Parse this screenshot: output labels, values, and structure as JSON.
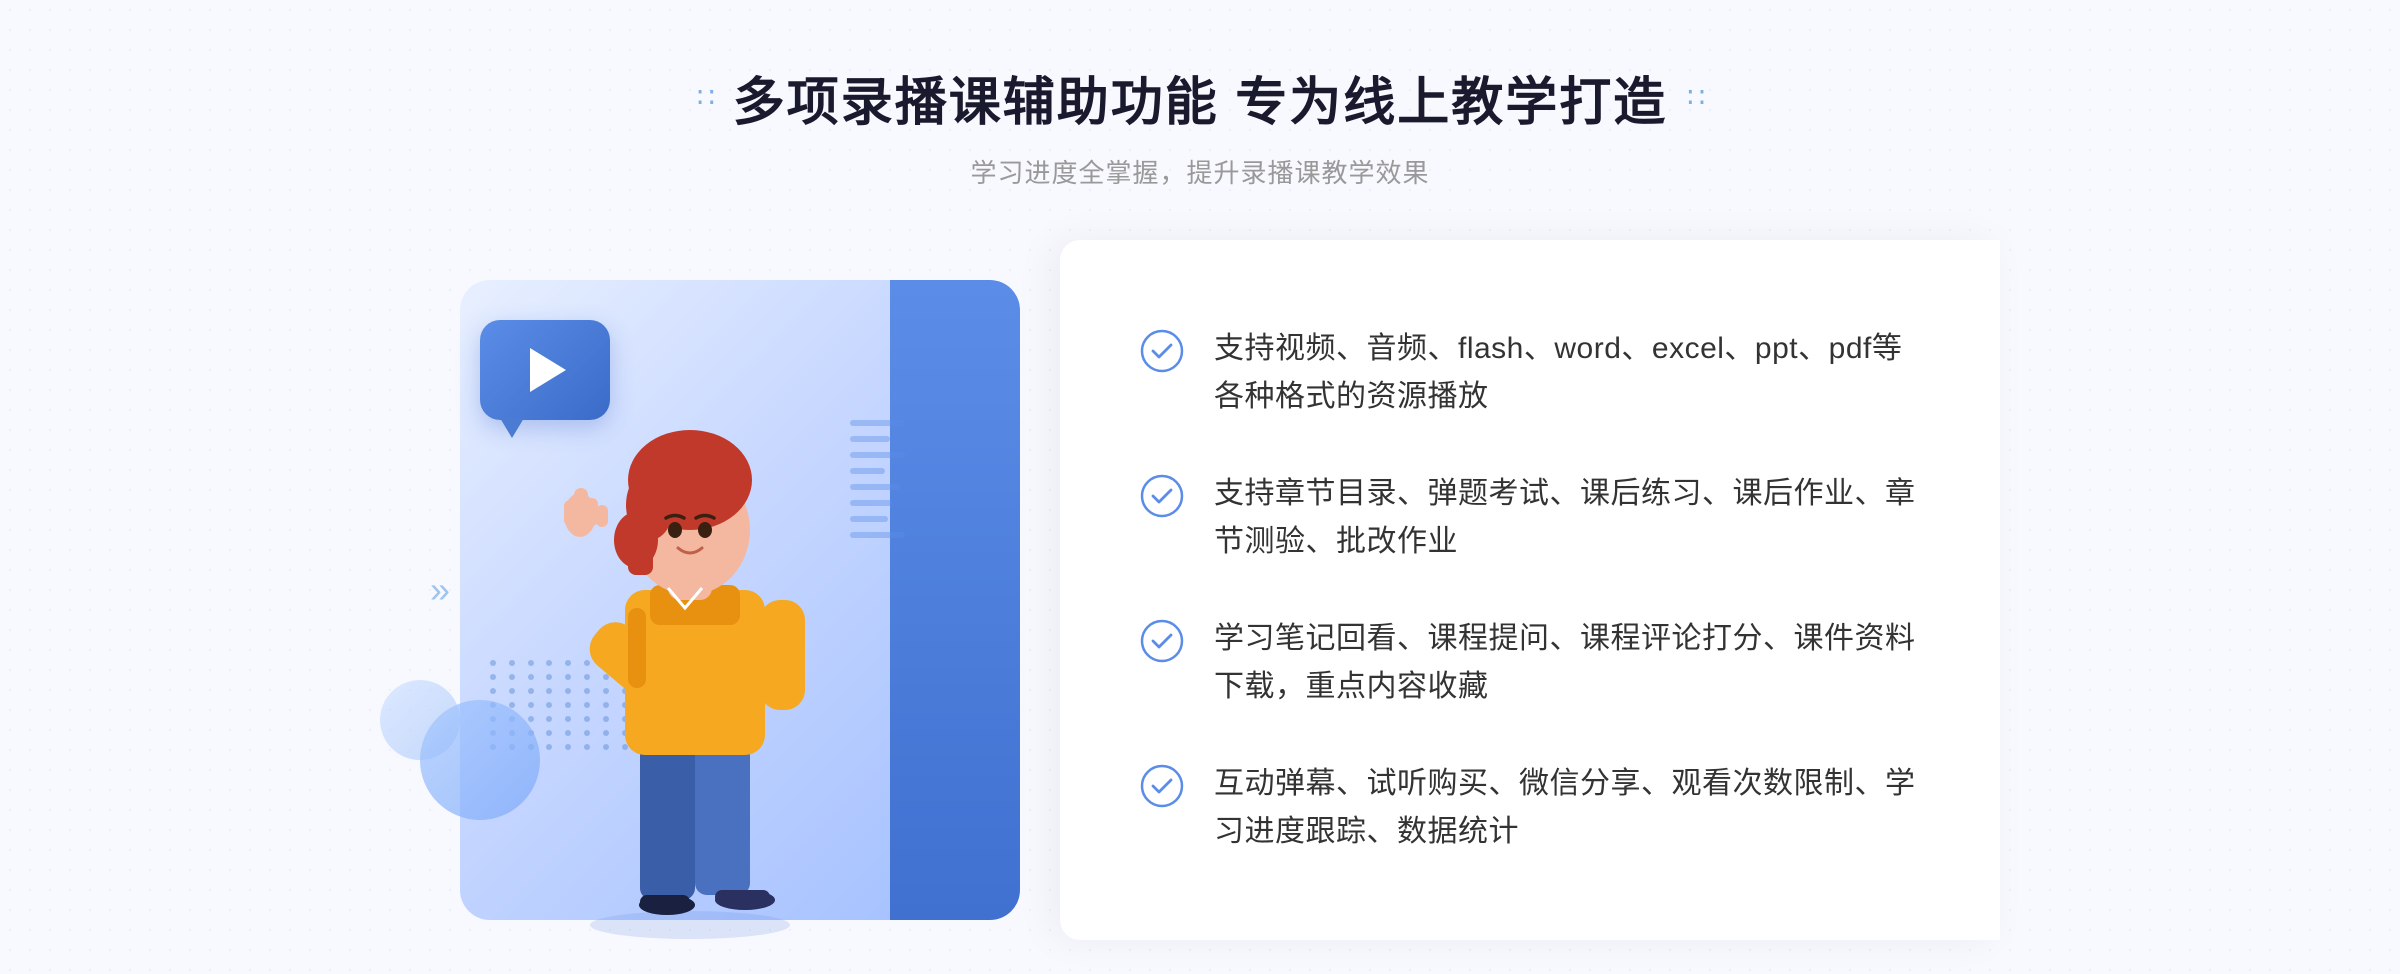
{
  "header": {
    "title_dots_left": "∷",
    "title_dots_right": "∷",
    "main_title": "多项录播课辅助功能 专为线上教学打造",
    "subtitle": "学习进度全掌握，提升录播课教学效果"
  },
  "features": [
    {
      "id": 1,
      "text": "支持视频、音频、flash、word、excel、ppt、pdf等各种格式的资源播放"
    },
    {
      "id": 2,
      "text": "支持章节目录、弹题考试、课后练习、课后作业、章节测验、批改作业"
    },
    {
      "id": 3,
      "text": "学习笔记回看、课程提问、课程评论打分、课件资料下载，重点内容收藏"
    },
    {
      "id": 4,
      "text": "互动弹幕、试听购买、微信分享、观看次数限制、学习进度跟踪、数据统计"
    }
  ],
  "decoration": {
    "arrow_symbol": "»",
    "play_button_label": "play"
  }
}
